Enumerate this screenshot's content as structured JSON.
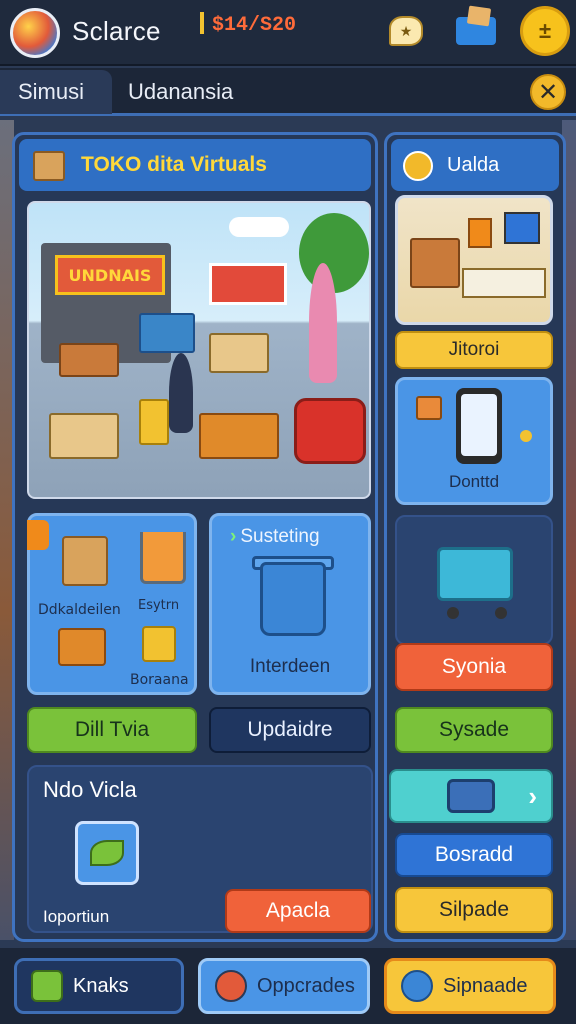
{
  "header": {
    "app_title": "Sclarce",
    "currency": "$14/S20",
    "level_badge": "±"
  },
  "tabs": [
    {
      "label": "Simusi",
      "active": true
    },
    {
      "label": "Udanansia",
      "active": false
    }
  ],
  "main": {
    "title": "TOKO dita Virtuals",
    "hero_sign": "UNDNAIS",
    "items_card": {
      "labels": [
        "Ddkaldeilen",
        "Esytrn",
        "Boraana"
      ]
    },
    "support_card": {
      "title": "Susteting",
      "label": "Interdeen"
    },
    "buttons": {
      "left": "Dill Tvia",
      "right": "Updaidre"
    },
    "news": {
      "title": "Ndo Vicla",
      "label": "Ioportiun",
      "action": "Apacla"
    }
  },
  "side": {
    "title": "Ualda",
    "card1_button": "Jitoroi",
    "card2_label": "Donttd",
    "btn_orange": "Syonia",
    "btn_green": "Sysade",
    "btn_blue": "Bosradd",
    "btn_yellow": "Silpade"
  },
  "bottom": {
    "btn1": "Knaks",
    "btn2": "Oppcrades",
    "btn3": "Sipnaade"
  },
  "colors": {
    "accent_blue": "#2f6fc4",
    "title_yellow": "#ffd83a",
    "button_green": "#7ac23a",
    "button_orange": "#f0623a",
    "button_yellow": "#f7c63a"
  }
}
